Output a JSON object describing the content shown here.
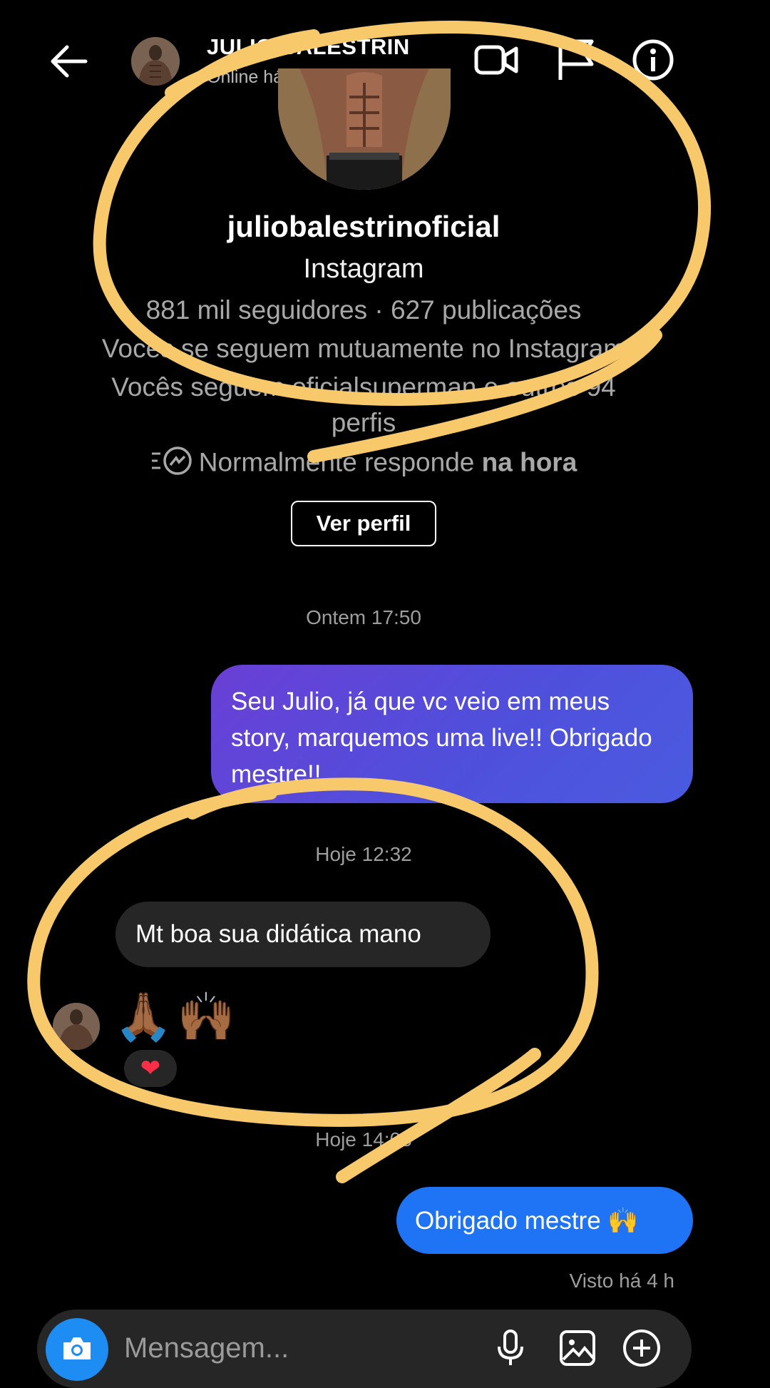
{
  "header": {
    "name": "JULIO BALESTRIN",
    "status": "Online há 12 min",
    "icons": [
      "back-arrow-icon",
      "video-call-icon",
      "flag-icon",
      "info-icon"
    ]
  },
  "profile": {
    "username": "juliobalestrinoficial",
    "network": "Instagram",
    "stats": "881 mil seguidores · 627 publicações",
    "mutual": "Vocês se seguem mutuamente no Instagram",
    "follows_line1": "Vocês seguem oficialsuperman e outros 94",
    "follows_line2": "perfis",
    "response_prefix": "Normalmente responde",
    "response_bold": "na hora",
    "view_profile": "Ver perfil"
  },
  "messages": {
    "stamp1": "Ontem 17:50",
    "outgoing1": "Seu Julio,  já que vc veio em meus story,  marquemos uma live!! Obrigado mestre!!",
    "stamp2": "Hoje 12:32",
    "incoming1": "Mt boa sua didática mano",
    "incoming_emoji1": "🙏🏾",
    "incoming_emoji2": "🙌🏾",
    "reaction": "❤",
    "stamp3": "Hoje 14:03",
    "outgoing2": "Obrigado mestre 🙌",
    "seen": "Visto há 4 h"
  },
  "composer": {
    "placeholder": "Mensagem..."
  },
  "colors": {
    "outgoing_gradient_start": "#6a3fd6",
    "outgoing_gradient_end": "#4a5be0",
    "outgoing_blue": "#1e74f5",
    "incoming_bubble": "#262626",
    "camera_button": "#1d8cf3",
    "annotation_scribble": "#f7c96b"
  }
}
